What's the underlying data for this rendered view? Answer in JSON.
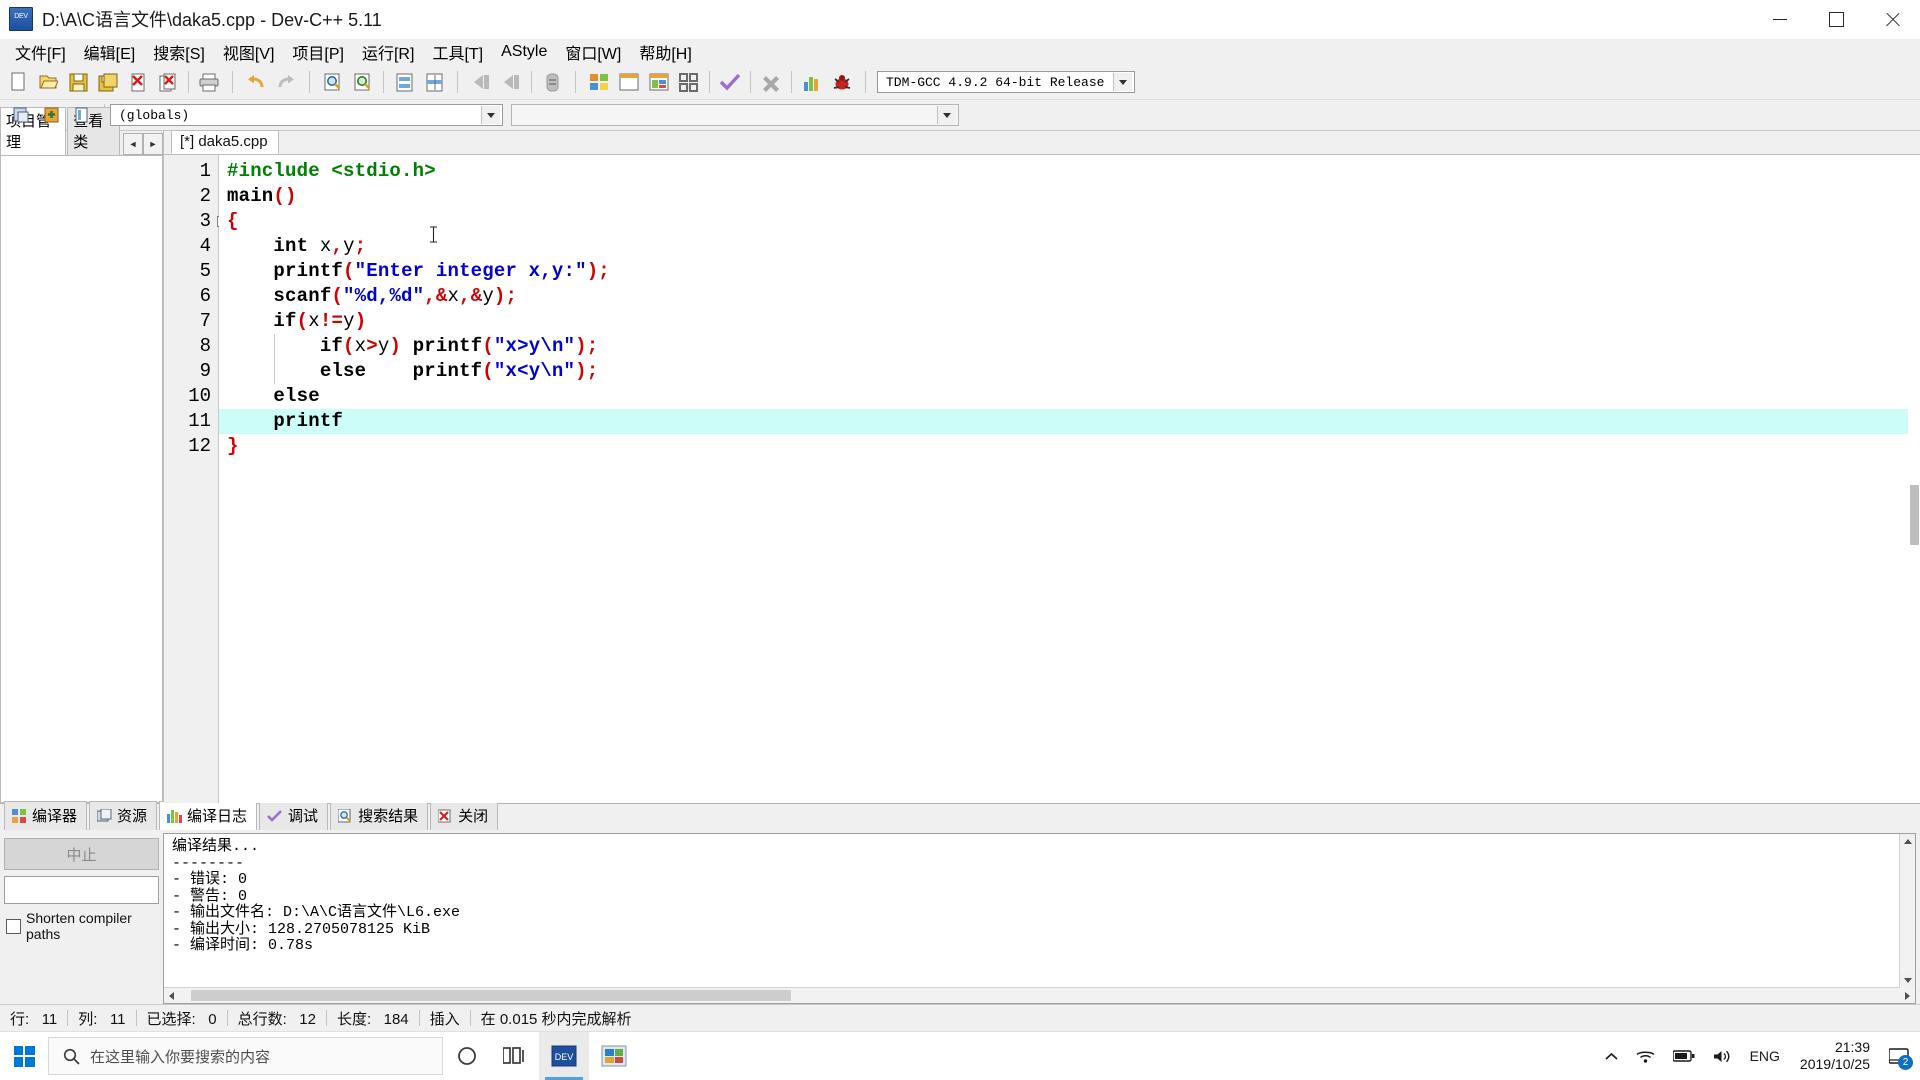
{
  "window": {
    "title": "D:\\A\\C语言文件\\daka5.cpp - Dev-C++ 5.11",
    "app_icon": "devcpp-icon",
    "minimize": "minimize-button",
    "maximize": "maximize-button",
    "close": "close-button"
  },
  "menu": {
    "items": [
      {
        "label": "文件[F]",
        "name": "menu-file"
      },
      {
        "label": "编辑[E]",
        "name": "menu-edit"
      },
      {
        "label": "搜索[S]",
        "name": "menu-search"
      },
      {
        "label": "视图[V]",
        "name": "menu-view"
      },
      {
        "label": "项目[P]",
        "name": "menu-project"
      },
      {
        "label": "运行[R]",
        "name": "menu-run"
      },
      {
        "label": "工具[T]",
        "name": "menu-tools"
      },
      {
        "label": "AStyle",
        "name": "menu-astyle"
      },
      {
        "label": "窗口[W]",
        "name": "menu-window"
      },
      {
        "label": "帮助[H]",
        "name": "menu-help"
      }
    ]
  },
  "toolbar": {
    "compiler_combo_value": "TDM-GCC 4.9.2 64-bit Release",
    "buttons": [
      "new-file-icon",
      "open-file-icon",
      "save-icon",
      "save-all-icon",
      "close-file-icon",
      "close-all-icon",
      "print-icon",
      "undo-icon",
      "redo-icon",
      "find-icon",
      "replace-icon",
      "goto-line-icon",
      "goto-function-icon",
      "back-icon",
      "forward-icon",
      "toggle-icon",
      "compile-icon",
      "run-icon",
      "compile-run-icon",
      "rebuild-icon",
      "check-syntax-icon",
      "stop-icon",
      "profile-icon",
      "debug-icon"
    ]
  },
  "toolbar2": {
    "scope_combo_value": "(globals)",
    "secondary_combo_value": "",
    "buttons": [
      "project-icon",
      "add-to-project-icon",
      "browse-icon"
    ]
  },
  "left_pane": {
    "tabs": [
      {
        "label": "项目管理",
        "name": "tab-project-manager",
        "active": true
      },
      {
        "label": "查看类",
        "name": "tab-class-browser",
        "active": false
      }
    ],
    "nav_prev": "◄",
    "nav_next": "►"
  },
  "editor": {
    "tab_label": "[*] daka5.cpp",
    "highlighted_line": 11,
    "lines": [
      {
        "n": 1,
        "tokens": [
          {
            "t": "#include <stdio.h>",
            "c": "k-prep"
          }
        ]
      },
      {
        "n": 2,
        "tokens": [
          {
            "t": "main",
            "c": "k-kw"
          },
          {
            "t": "()",
            "c": "k-sym"
          }
        ]
      },
      {
        "n": 3,
        "tokens": [
          {
            "t": "{",
            "c": "k-sym"
          }
        ]
      },
      {
        "n": 4,
        "tokens": [
          {
            "t": "    ",
            "c": "k-id"
          },
          {
            "t": "int",
            "c": "k-kw"
          },
          {
            "t": " x",
            "c": "k-id"
          },
          {
            "t": ",",
            "c": "k-sym"
          },
          {
            "t": "y",
            "c": "k-id"
          },
          {
            "t": ";",
            "c": "k-sym"
          }
        ]
      },
      {
        "n": 5,
        "tokens": [
          {
            "t": "    ",
            "c": "k-id"
          },
          {
            "t": "printf",
            "c": "k-kw"
          },
          {
            "t": "(",
            "c": "k-sym"
          },
          {
            "t": "\"Enter integer x,y:\"",
            "c": "k-str"
          },
          {
            "t": ");",
            "c": "k-sym"
          }
        ]
      },
      {
        "n": 6,
        "tokens": [
          {
            "t": "    ",
            "c": "k-id"
          },
          {
            "t": "scanf",
            "c": "k-kw"
          },
          {
            "t": "(",
            "c": "k-sym"
          },
          {
            "t": "\"%d,%d\"",
            "c": "k-str"
          },
          {
            "t": ",",
            "c": "k-sym"
          },
          {
            "t": "&",
            "c": "k-sym"
          },
          {
            "t": "x",
            "c": "k-id"
          },
          {
            "t": ",",
            "c": "k-sym"
          },
          {
            "t": "&",
            "c": "k-sym"
          },
          {
            "t": "y",
            "c": "k-id"
          },
          {
            "t": ");",
            "c": "k-sym"
          }
        ]
      },
      {
        "n": 7,
        "tokens": [
          {
            "t": "    ",
            "c": "k-id"
          },
          {
            "t": "if",
            "c": "k-kw"
          },
          {
            "t": "(",
            "c": "k-sym"
          },
          {
            "t": "x",
            "c": "k-id"
          },
          {
            "t": "!=",
            "c": "k-sym"
          },
          {
            "t": "y",
            "c": "k-id"
          },
          {
            "t": ")",
            "c": "k-sym"
          }
        ]
      },
      {
        "n": 8,
        "tokens": [
          {
            "t": "        ",
            "c": "k-id"
          },
          {
            "t": "if",
            "c": "k-kw"
          },
          {
            "t": "(",
            "c": "k-sym"
          },
          {
            "t": "x",
            "c": "k-id"
          },
          {
            "t": ">",
            "c": "k-sym"
          },
          {
            "t": "y",
            "c": "k-id"
          },
          {
            "t": ") ",
            "c": "k-sym"
          },
          {
            "t": "printf",
            "c": "k-kw"
          },
          {
            "t": "(",
            "c": "k-sym"
          },
          {
            "t": "\"x>y\\n\"",
            "c": "k-str"
          },
          {
            "t": ");",
            "c": "k-sym"
          }
        ]
      },
      {
        "n": 9,
        "tokens": [
          {
            "t": "        ",
            "c": "k-id"
          },
          {
            "t": "else",
            "c": "k-kw"
          },
          {
            "t": "    ",
            "c": "k-id"
          },
          {
            "t": "printf",
            "c": "k-kw"
          },
          {
            "t": "(",
            "c": "k-sym"
          },
          {
            "t": "\"x<y\\n\"",
            "c": "k-str"
          },
          {
            "t": ");",
            "c": "k-sym"
          }
        ]
      },
      {
        "n": 10,
        "tokens": [
          {
            "t": "    ",
            "c": "k-id"
          },
          {
            "t": "else",
            "c": "k-kw"
          }
        ]
      },
      {
        "n": 11,
        "tokens": [
          {
            "t": "    ",
            "c": "k-id"
          },
          {
            "t": "printf",
            "c": "k-kw"
          }
        ]
      },
      {
        "n": 12,
        "tokens": [
          {
            "t": "}",
            "c": "k-sym"
          }
        ]
      }
    ]
  },
  "bottom_panel": {
    "tabs": [
      {
        "label": "编译器",
        "name": "tab-compiler",
        "icon": "compiler-icon",
        "active": false
      },
      {
        "label": "资源",
        "name": "tab-resources",
        "icon": "resources-icon",
        "active": false
      },
      {
        "label": "编译日志",
        "name": "tab-compile-log",
        "icon": "compile-log-icon",
        "active": true
      },
      {
        "label": "调试",
        "name": "tab-debug",
        "icon": "debug-check-icon",
        "active": false
      },
      {
        "label": "搜索结果",
        "name": "tab-search-results",
        "icon": "search-results-icon",
        "active": false
      },
      {
        "label": "关闭",
        "name": "tab-close",
        "icon": "close-panel-icon",
        "active": false
      }
    ],
    "abort_button": "中止",
    "shorten_paths_label": "Shorten compiler paths",
    "log_lines": [
      "编译结果...",
      "--------",
      "- 错误: 0",
      "- 警告: 0",
      "- 输出文件名: D:\\A\\C语言文件\\L6.exe",
      "- 输出大小: 128.2705078125 KiB",
      "- 编译时间: 0.78s"
    ]
  },
  "status_bar": {
    "row_label": "行:",
    "row_value": "11",
    "col_label": "列:",
    "col_value": "11",
    "selected_label": "已选择:",
    "selected_value": "0",
    "total_lines_label": "总行数:",
    "total_lines_value": "12",
    "length_label": "长度:",
    "length_value": "184",
    "insert_mode": "插入",
    "parse_status": "在 0.015 秒内完成解析"
  },
  "taskbar": {
    "start": "windows-start-icon",
    "search_placeholder": "在这里输入你要搜索的内容",
    "task_view": "task-view-icon",
    "apps": [
      {
        "name": "taskbar-app-cortana",
        "icon": "cortana-icon"
      },
      {
        "name": "taskbar-app-taskview",
        "icon": "task-view-icon"
      },
      {
        "name": "taskbar-app-devcpp",
        "icon": "devcpp-icon",
        "active": true
      },
      {
        "name": "taskbar-app-explorer",
        "icon": "explorer-icon",
        "active": false
      }
    ],
    "tray": {
      "chevron": "show-hidden-icons",
      "network": "network-icon",
      "battery": "battery-icon",
      "volume": "volume-icon",
      "language": "ENG"
    },
    "clock_time": "21:39",
    "clock_date": "2019/10/25",
    "notification_count": "2"
  },
  "colors": {
    "highlight_line": "#cdfdf8",
    "string": "#0000d0",
    "preprocessor": "#008000",
    "symbol": "#d00000",
    "accent": "#0078d7"
  }
}
